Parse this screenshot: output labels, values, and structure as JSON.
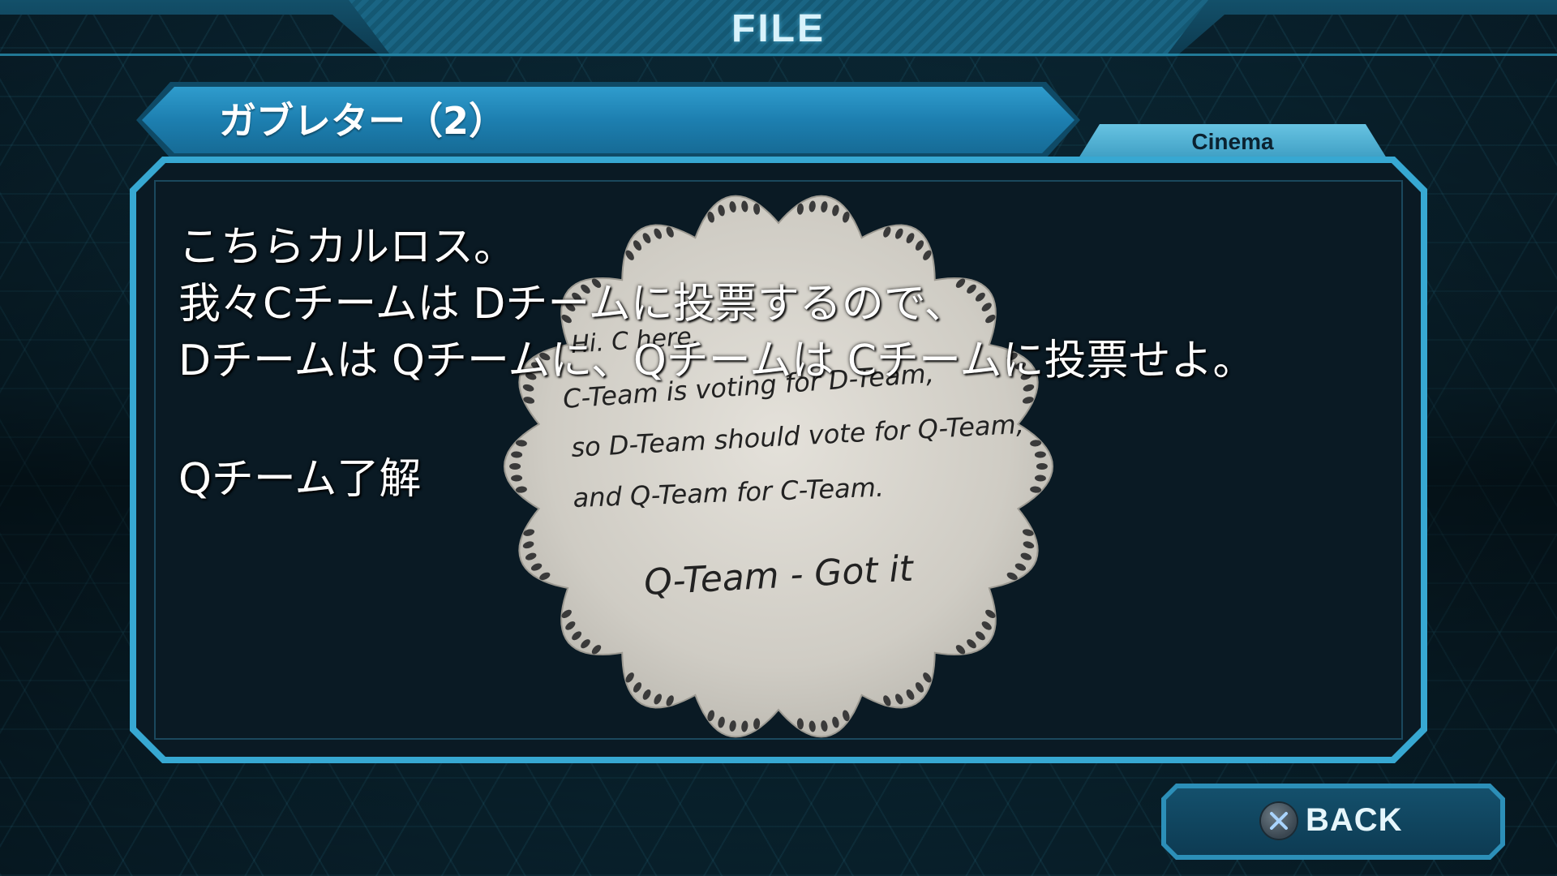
{
  "header": {
    "title": "FILE"
  },
  "file": {
    "title": "ガブレター（2）",
    "category": "Cinema",
    "lines": [
      "こちらカルロス。",
      "我々Cチームは Dチームに投票するので、",
      "Dチームは Qチームに、Qチームは Cチームに投票せよ。",
      "Qチーム了解"
    ]
  },
  "note": {
    "handwritten_lines": [
      "Hi. C here.",
      "C-Team is voting for D-Team,",
      "so D-Team should vote for Q-Team,",
      "and Q-Team for C-Team.",
      "Q-Team - Got it"
    ]
  },
  "back_button": {
    "label": "BACK",
    "icon": "cross-button-icon"
  }
}
